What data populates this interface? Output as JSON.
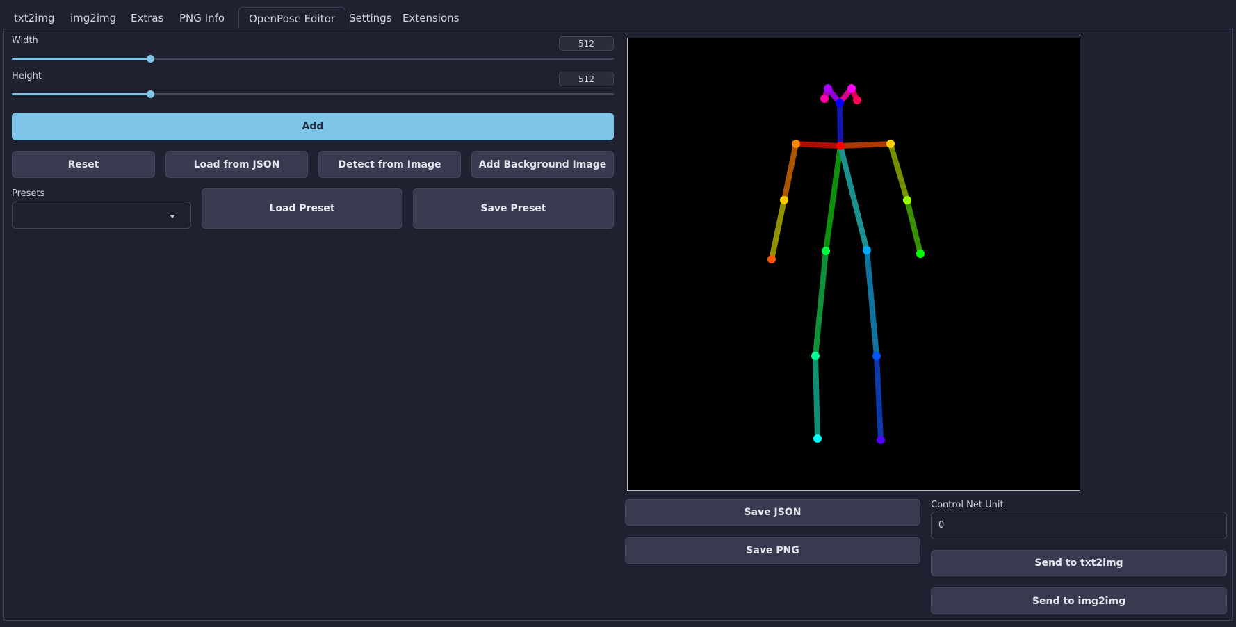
{
  "tabs": [
    {
      "label": "txt2img"
    },
    {
      "label": "img2img"
    },
    {
      "label": "Extras"
    },
    {
      "label": "PNG Info"
    },
    {
      "label": "OpenPose Editor"
    },
    {
      "label": "Settings"
    },
    {
      "label": "Extensions"
    }
  ],
  "active_tab": "OpenPose Editor",
  "width": {
    "label": "Width",
    "value": "512",
    "slider_fraction": 0.23
  },
  "height": {
    "label": "Height",
    "value": "512",
    "slider_fraction": 0.23
  },
  "buttons": {
    "add": "Add",
    "reset": "Reset",
    "load_json": "Load from JSON",
    "detect_image": "Detect from Image",
    "add_background": "Add Background Image",
    "load_preset": "Load Preset",
    "save_preset": "Save Preset",
    "save_json": "Save JSON",
    "save_png": "Save PNG",
    "send_txt2img": "Send to txt2img",
    "send_img2img": "Send to img2img"
  },
  "presets": {
    "label": "Presets",
    "value": ""
  },
  "control_net": {
    "label": "Control Net Unit",
    "value": "0"
  },
  "colors": {
    "accent": "#7ec4e6",
    "background": "#1f2130",
    "button": "#383b4f",
    "canvas": "#000000"
  },
  "icons": {
    "dropdown": "chevron-down-icon"
  }
}
